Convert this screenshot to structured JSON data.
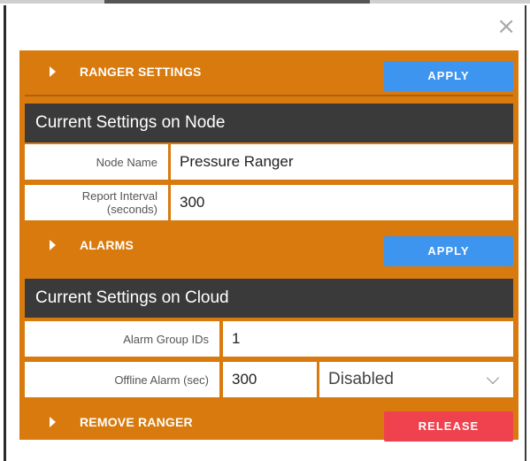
{
  "window": {
    "close_glyph": "×"
  },
  "sections": {
    "ranger_settings": {
      "title": "RANGER SETTINGS",
      "button": "APPLY"
    },
    "alarms": {
      "title": "ALARMS",
      "button": "APPLY"
    },
    "remove_ranger": {
      "title": "REMOVE RANGER",
      "button": "RELEASE"
    }
  },
  "node_settings": {
    "heading": "Current Settings on Node",
    "node_name_label": "Node Name",
    "node_name_value": "Pressure Ranger",
    "report_interval_label_1": "Report Interval",
    "report_interval_label_2": "(seconds)",
    "report_interval_value": "300"
  },
  "cloud_settings": {
    "heading": "Current Settings on Cloud",
    "alarm_group_label": "Alarm Group IDs",
    "alarm_group_value": "1",
    "offline_alarm_label": "Offline Alarm (sec)",
    "offline_alarm_value": "300",
    "offline_alarm_mode": "Disabled"
  },
  "colors": {
    "orange": "#d87a0e",
    "dark": "#3a3a3a",
    "blue": "#3e95f0",
    "red": "#f0424e"
  }
}
